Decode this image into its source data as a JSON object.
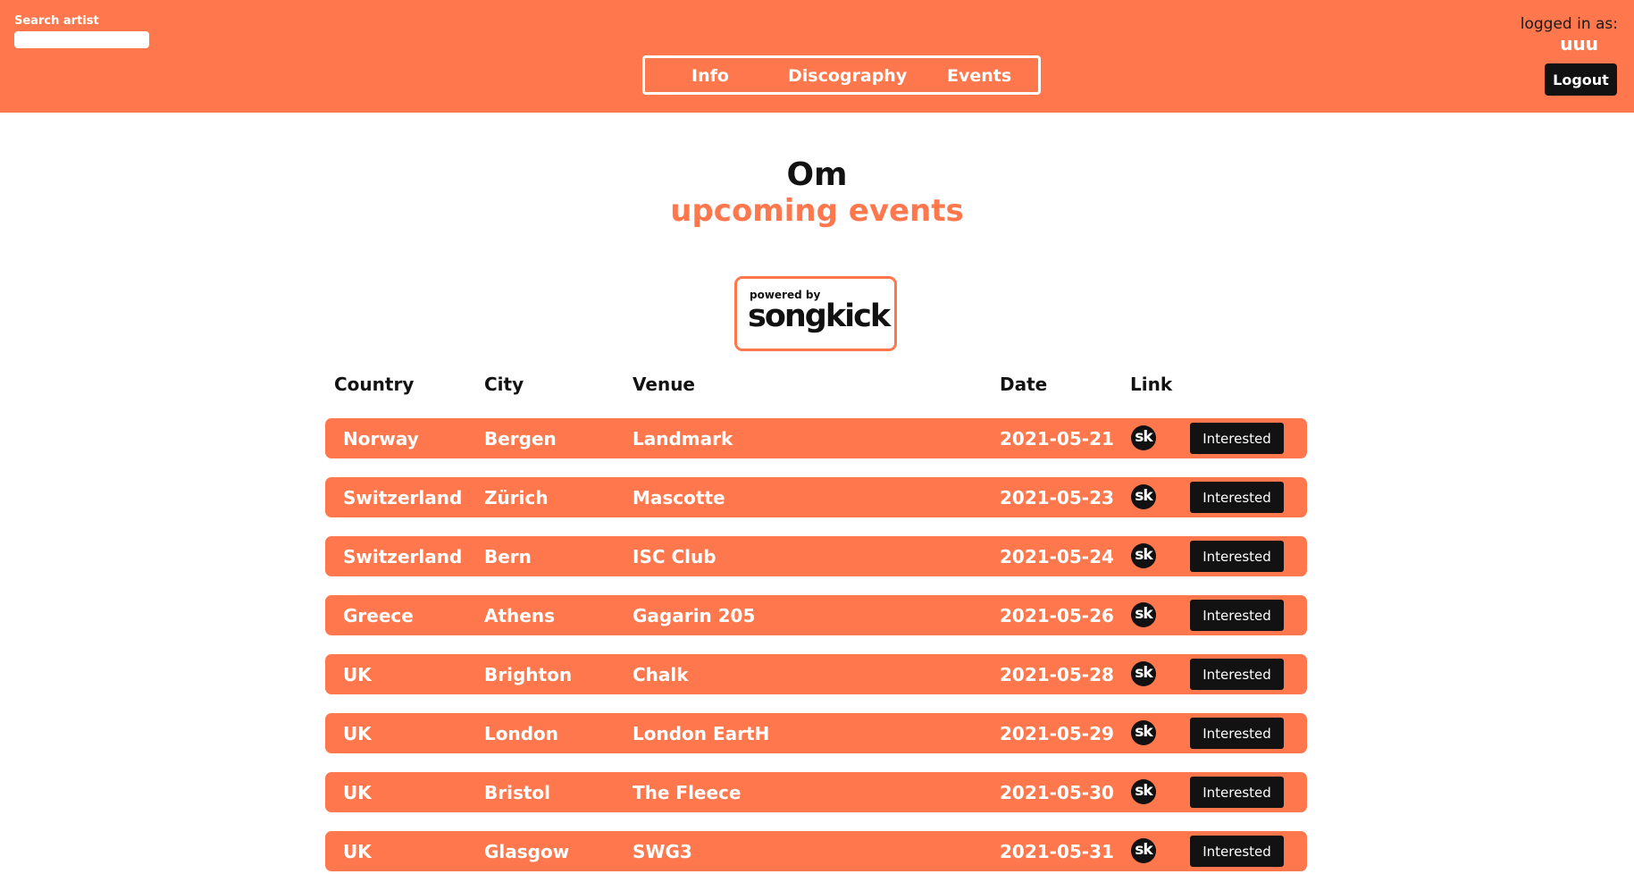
{
  "header": {
    "search_label": "Search artist",
    "search_value": "",
    "search_placeholder": "",
    "nav": {
      "info": "Info",
      "discography": "Discography",
      "events": "Events"
    },
    "login_label": "logged in as:",
    "username": "uuu",
    "logout_label": "Logout"
  },
  "main": {
    "artist_name": "Om",
    "section_title": "upcoming events",
    "badge": {
      "powered_by": "powered by",
      "brand": "songkick"
    },
    "columns": {
      "country": "Country",
      "city": "City",
      "venue": "Venue",
      "date": "Date",
      "link": "Link"
    },
    "events": [
      {
        "country": "Norway",
        "city": "Bergen",
        "venue": "Landmark",
        "date": "2021-05-21",
        "link_icon": "sk",
        "action": "Interested"
      },
      {
        "country": "Switzerland",
        "city": "Zürich",
        "venue": "Mascotte",
        "date": "2021-05-23",
        "link_icon": "sk",
        "action": "Interested"
      },
      {
        "country": "Switzerland",
        "city": "Bern",
        "venue": "ISC Club",
        "date": "2021-05-24",
        "link_icon": "sk",
        "action": "Interested"
      },
      {
        "country": "Greece",
        "city": "Athens",
        "venue": "Gagarin 205",
        "date": "2021-05-26",
        "link_icon": "sk",
        "action": "Interested"
      },
      {
        "country": "UK",
        "city": "Brighton",
        "venue": "Chalk",
        "date": "2021-05-28",
        "link_icon": "sk",
        "action": "Interested"
      },
      {
        "country": "UK",
        "city": "London",
        "venue": "London EartH",
        "date": "2021-05-29",
        "link_icon": "sk",
        "action": "Interested"
      },
      {
        "country": "UK",
        "city": "Bristol",
        "venue": "The Fleece",
        "date": "2021-05-30",
        "link_icon": "sk",
        "action": "Interested"
      },
      {
        "country": "UK",
        "city": "Glasgow",
        "venue": "SWG3",
        "date": "2021-05-31",
        "link_icon": "sk",
        "action": "Interested"
      }
    ]
  },
  "colors": {
    "accent": "#ff774c",
    "dark": "#121212",
    "background": "#ffffff"
  }
}
